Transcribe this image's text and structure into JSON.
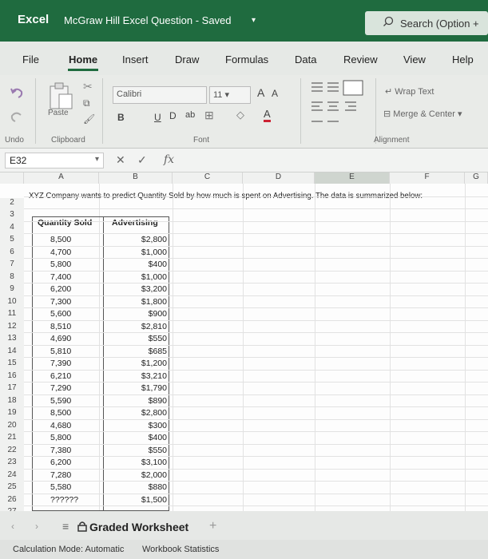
{
  "titlebar": {
    "app": "Excel",
    "document": "McGraw Hill Excel Question - Saved",
    "search_placeholder": "Search (Option +"
  },
  "tabs": [
    "File",
    "Home",
    "Insert",
    "Draw",
    "Formulas",
    "Data",
    "Review",
    "View",
    "Help"
  ],
  "ribbon": {
    "undo": "Undo",
    "paste": "Paste",
    "clipboard": "Clipboard",
    "font_name": "Calibri",
    "font_size": "11",
    "bold": "B",
    "underline": "U",
    "font_group": "Font",
    "wrap_text": "Wrap Text",
    "merge_center": "Merge & Center",
    "alignment": "Alignment"
  },
  "formula_bar": {
    "name_box": "E32",
    "fx": "fx"
  },
  "columns": [
    "A",
    "B",
    "C",
    "D",
    "E",
    "F",
    "G"
  ],
  "sheet": {
    "row2_text": "XYZ Company wants to predict Quantity Sold by how much is spent on Advertising. The data is summarized below:",
    "header_qty": "Quantity Sold",
    "header_adv": "Advertising",
    "rows": [
      {
        "r": "5",
        "q": "8,500",
        "a": "$2,800"
      },
      {
        "r": "6",
        "q": "4,700",
        "a": "$1,000"
      },
      {
        "r": "7",
        "q": "5,800",
        "a": "$400"
      },
      {
        "r": "8",
        "q": "7,400",
        "a": "$1,000"
      },
      {
        "r": "9",
        "q": "6,200",
        "a": "$3,200"
      },
      {
        "r": "10",
        "q": "7,300",
        "a": "$1,800"
      },
      {
        "r": "11",
        "q": "5,600",
        "a": "$900"
      },
      {
        "r": "12",
        "q": "8,510",
        "a": "$2,810"
      },
      {
        "r": "13",
        "q": "4,690",
        "a": "$550"
      },
      {
        "r": "14",
        "q": "5,810",
        "a": "$685"
      },
      {
        "r": "15",
        "q": "7,390",
        "a": "$1,200"
      },
      {
        "r": "16",
        "q": "6,210",
        "a": "$3,210"
      },
      {
        "r": "17",
        "q": "7,290",
        "a": "$1,790"
      },
      {
        "r": "18",
        "q": "5,590",
        "a": "$890"
      },
      {
        "r": "19",
        "q": "8,500",
        "a": "$2,800"
      },
      {
        "r": "20",
        "q": "4,680",
        "a": "$300"
      },
      {
        "r": "21",
        "q": "5,800",
        "a": "$400"
      },
      {
        "r": "22",
        "q": "7,380",
        "a": "$550"
      },
      {
        "r": "23",
        "q": "6,200",
        "a": "$3,100"
      },
      {
        "r": "24",
        "q": "7,280",
        "a": "$2,000"
      },
      {
        "r": "25",
        "q": "5,580",
        "a": "$880"
      },
      {
        "r": "26",
        "q": "??????",
        "a": "$1,500"
      }
    ]
  },
  "sheet_tabs": {
    "active": "Graded Worksheet",
    "add": "+"
  },
  "status": {
    "calc_mode": "Calculation Mode: Automatic",
    "stats": "Workbook Statistics"
  }
}
